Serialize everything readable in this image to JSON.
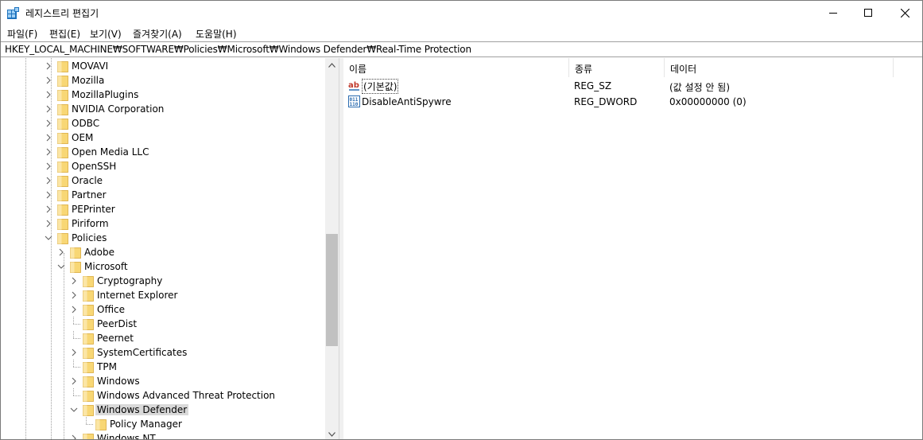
{
  "window": {
    "title": "레지스트리 편집기"
  },
  "menu": [
    "파일(F)",
    "편집(E)",
    "보기(V)",
    "즐겨찾기(A)",
    "도움말(H)"
  ],
  "address": "HKEY_LOCAL_MACHINE₩SOFTWARE₩Policies₩Microsoft₩Windows Defender₩Real-Time Protection",
  "tree": [
    {
      "label": "MOVAVI",
      "expander": "collapsed"
    },
    {
      "label": "Mozilla",
      "expander": "collapsed"
    },
    {
      "label": "MozillaPlugins",
      "expander": "collapsed"
    },
    {
      "label": "NVIDIA Corporation",
      "expander": "collapsed"
    },
    {
      "label": "ODBC",
      "expander": "collapsed"
    },
    {
      "label": "OEM",
      "expander": "collapsed"
    },
    {
      "label": "Open Media LLC",
      "expander": "collapsed"
    },
    {
      "label": "OpenSSH",
      "expander": "collapsed"
    },
    {
      "label": "Oracle",
      "expander": "collapsed"
    },
    {
      "label": "Partner",
      "expander": "collapsed"
    },
    {
      "label": "PEPrinter",
      "expander": "collapsed"
    },
    {
      "label": "Piriform",
      "expander": "collapsed"
    },
    {
      "label": "Policies",
      "expander": "expanded"
    },
    {
      "label": "Adobe",
      "expander": "collapsed"
    },
    {
      "label": "Microsoft",
      "expander": "expanded"
    },
    {
      "label": "Cryptography",
      "expander": "collapsed"
    },
    {
      "label": "Internet Explorer",
      "expander": "collapsed"
    },
    {
      "label": "Office",
      "expander": "collapsed"
    },
    {
      "label": "PeerDist",
      "expander": "none"
    },
    {
      "label": "Peernet",
      "expander": "none"
    },
    {
      "label": "SystemCertificates",
      "expander": "collapsed"
    },
    {
      "label": "TPM",
      "expander": "none"
    },
    {
      "label": "Windows",
      "expander": "collapsed"
    },
    {
      "label": "Windows Advanced Threat Protection",
      "expander": "none"
    },
    {
      "label": "Windows Defender",
      "expander": "expanded",
      "selected": true
    },
    {
      "label": "Policy Manager",
      "expander": "none"
    },
    {
      "label": "Windows NT",
      "expander": "collapsed"
    }
  ],
  "list": {
    "columns": [
      "이름",
      "종류",
      "데이터"
    ],
    "rows": [
      {
        "icon": "string-value-icon",
        "name": "(기본값)",
        "type": "REG_SZ",
        "data": "(값 설정 안 됨)"
      },
      {
        "icon": "dword-value-icon",
        "name": "DisableAntiSpywre",
        "type": "REG_DWORD",
        "data": "0x00000000 (0)"
      }
    ]
  },
  "colors": {
    "folder": "#f8d775",
    "selection": "#d9d9d9",
    "scroll_thumb": "#c1c1c1"
  }
}
